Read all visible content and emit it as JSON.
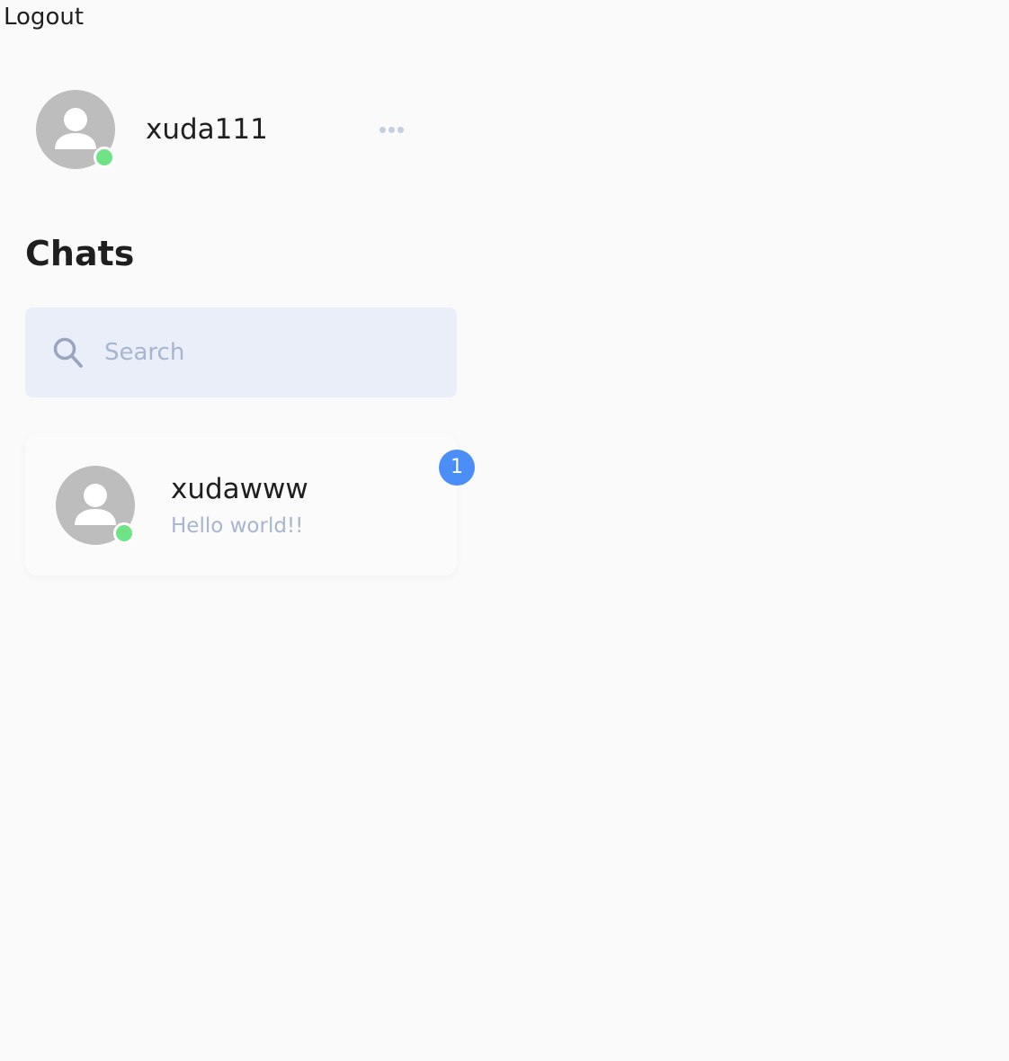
{
  "header": {
    "logout_label": "Logout"
  },
  "profile": {
    "username": "xuda111",
    "status": "online",
    "avatar_icon": "user-icon",
    "more_icon": "more-horizontal-icon"
  },
  "chats": {
    "title": "Chats",
    "search": {
      "placeholder": "Search",
      "value": "",
      "icon": "search-icon"
    },
    "items": [
      {
        "name": "xudawww",
        "last_message": "Hello world!!",
        "unread_count": "1",
        "status": "online",
        "avatar_icon": "user-icon"
      }
    ]
  },
  "colors": {
    "background": "#fafafa",
    "avatar": "#bdbdbd",
    "online": "#6ee487",
    "badge": "#4c8ef7",
    "search_bg": "#e9eef9",
    "muted_text": "#a7b5cf"
  }
}
